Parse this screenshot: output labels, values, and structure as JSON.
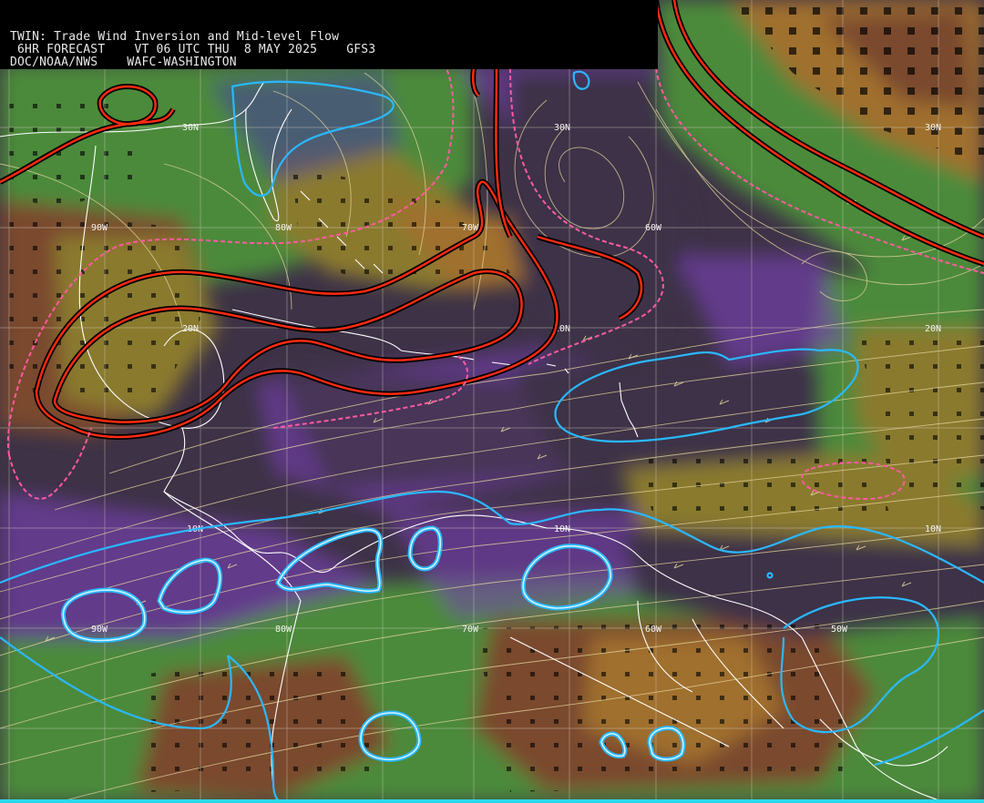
{
  "header": {
    "line1": "TWIN: Trade Wind Inversion and Mid-level Flow",
    "line2": " 6HR FORECAST    VT 06 UTC THU  8 MAY 2025    GFS3",
    "line3": "DOC/NOAA/NWS    WAFC-WASHINGTON"
  },
  "grid_labels": {
    "lat30_w": "30N",
    "lat30_c": "30N",
    "lat30_e": "30N",
    "lat20_w": "20N",
    "lat20_c": "20N",
    "lat20_e": "20N",
    "lat10_w": "10N",
    "lat10_c": "10N",
    "lat10_e": "10N",
    "lon90_n": "90W",
    "lon80_n": "80W",
    "lon70_n": "70W",
    "lon60_n": "60W",
    "lon90_s": "90W",
    "lon80_s": "80W",
    "lon70_s": "70W",
    "lon60_s": "60W",
    "lon50_s": "50W"
  },
  "colors": {
    "ocean_base": "#3d3246",
    "purple": "#7b3fb8",
    "slate": "#4a4a8a",
    "green": "#4b8a3a",
    "olive": "#8a7a2e",
    "tan": "#a0702e",
    "brown": "#7a4a2e",
    "streamline": "#e8d8a0",
    "inversion_red": "#ff2a10",
    "inversion_pink": "#ff5aa0",
    "cyan_contour": "#2ab8ff",
    "coastline": "#ffffff"
  }
}
